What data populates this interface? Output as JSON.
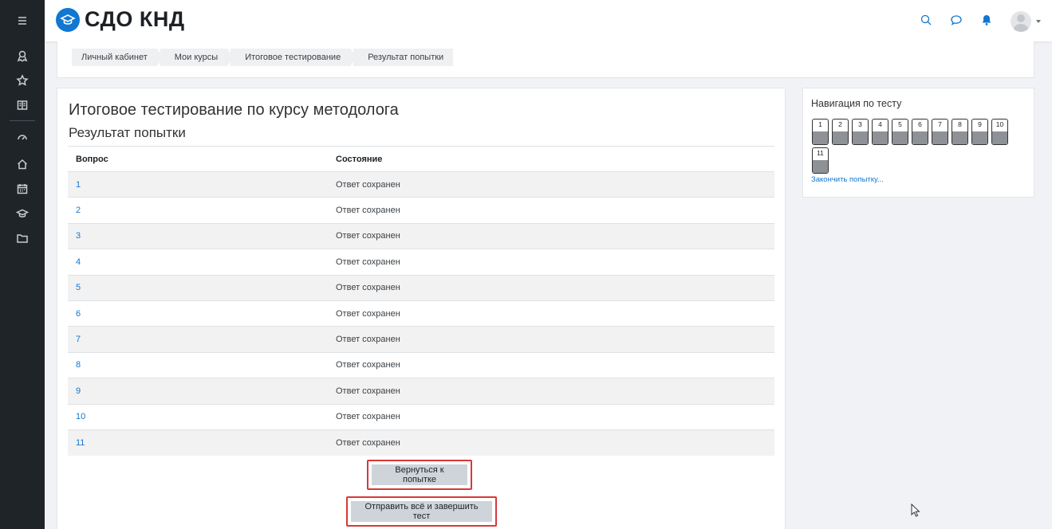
{
  "header": {
    "brand": "СДО КНД",
    "icons": [
      "search-icon",
      "messages-icon",
      "notifications-icon",
      "user-avatar"
    ]
  },
  "sidebar": {
    "items": [
      "menu-icon",
      "badge-icon",
      "star-icon",
      "book-icon",
      "dashboard-icon",
      "home-icon",
      "calendar-icon",
      "courses-icon",
      "folder-icon"
    ]
  },
  "breadcrumb": [
    "Личный кабинет",
    "Мои курсы",
    "Итоговое тестирование",
    "Результат попытки"
  ],
  "main": {
    "title": "Итоговое тестирование по курсу методолога",
    "subtitle": "Результат попытки",
    "table": {
      "headers": [
        "Вопрос",
        "Состояние"
      ],
      "rows": [
        {
          "q": "1",
          "status": "Ответ сохранен"
        },
        {
          "q": "2",
          "status": "Ответ сохранен"
        },
        {
          "q": "3",
          "status": "Ответ сохранен"
        },
        {
          "q": "4",
          "status": "Ответ сохранен"
        },
        {
          "q": "5",
          "status": "Ответ сохранен"
        },
        {
          "q": "6",
          "status": "Ответ сохранен"
        },
        {
          "q": "7",
          "status": "Ответ сохранен"
        },
        {
          "q": "8",
          "status": "Ответ сохранен"
        },
        {
          "q": "9",
          "status": "Ответ сохранен"
        },
        {
          "q": "10",
          "status": "Ответ сохранен"
        },
        {
          "q": "11",
          "status": "Ответ сохранен"
        }
      ]
    },
    "return_button": "Вернуться к попытке",
    "submit_button": "Отправить всё и завершить тест"
  },
  "quiz_nav": {
    "title": "Навигация по тесту",
    "questions": [
      "1",
      "2",
      "3",
      "4",
      "5",
      "6",
      "7",
      "8",
      "9",
      "10",
      "11"
    ],
    "finish_link": "Закончить попытку..."
  },
  "colors": {
    "accent": "#1177d1",
    "sidebar": "#1f2428",
    "highlight": "#d93838"
  }
}
